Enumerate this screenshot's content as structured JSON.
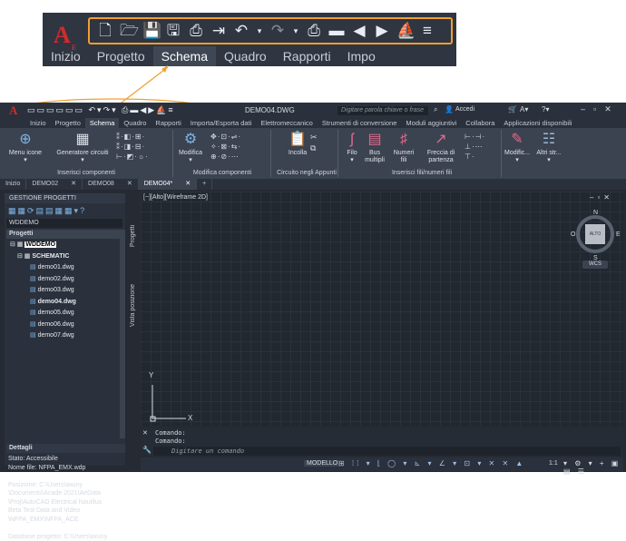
{
  "zoom": {
    "logo_letter": "A",
    "logo_sub": "E",
    "qat_icons": [
      "new-icon",
      "open-icon",
      "save-icon",
      "save-as-icon",
      "export-icon",
      "import-icon",
      "undo-icon",
      "dropdown-icon",
      "redo-icon",
      "dropdown-icon",
      "print-icon",
      "folder-icon",
      "back-icon",
      "forward-icon",
      "surf-icon",
      "customize-icon"
    ],
    "tabs": [
      "Inizio",
      "Progetto",
      "Schema",
      "Quadro",
      "Rapporti",
      "Impo"
    ],
    "active_tab": "Schema"
  },
  "titlebar": {
    "doc_title": "DEMO04.DWG",
    "search_placeholder": "Digitare parola chiave o frase",
    "signin": "Accedi"
  },
  "ribbon_tabs": [
    "Inizio",
    "Progetto",
    "Schema",
    "Quadro",
    "Rapporti",
    "Importa/Esporta dati",
    "Elettromeccanico",
    "Strumenti di conversione",
    "Moduli aggiuntivi",
    "Collabora",
    "Applicazioni disponibili"
  ],
  "ribbon": {
    "menu_icone": "Menu icone",
    "generatore": "Generatore circuiti",
    "inserisci_componenti": "Inserisci componenti",
    "modifica": "Modifica",
    "modifica_componenti": "Modifica componenti",
    "incolla": "Incolla",
    "circuito_appunti": "Circuito negli Appunti",
    "filo": "Filo",
    "bus": "Bus multipli",
    "numeri_fili": "Numeri fili",
    "freccia": "Freccia di partenza",
    "inserisci_fili": "Inserisci fili/numeri fili",
    "modific": "Modific...",
    "altri": "Altri str..."
  },
  "doc_tabs": [
    "Inizio",
    "DEMO02",
    "DEMO08",
    "DEMO04*"
  ],
  "side": {
    "title": "GESTIONE PROGETTI",
    "project_select": "WDDEMO",
    "progetti": "Progetti",
    "root": "WDDEMO",
    "folder": "SCHEMATIC",
    "files": [
      "demo01.dwg",
      "demo02.dwg",
      "demo03.dwg",
      "demo04.dwg",
      "demo05.dwg",
      "demo06.dwg",
      "demo07.dwg"
    ],
    "dettagli": "Dettagli",
    "details": [
      "Stato: Accessibile",
      "Nome file: NFPA_EMX.wdp",
      "",
      "Posizione: C:\\Users\\axuny",
      "\\Documents\\Acade 2021\\AeData",
      "\\Proj\\AutoCAD Electrical Nautilus",
      "Beta Test Data and Video",
      "\\NFPA_EMX\\NFPA_ACE",
      "",
      "Database progetto: C:\\Users\\axuny"
    ],
    "vtab_progetti": "Progetti",
    "vtab_vista": "Vista posizione"
  },
  "canvas": {
    "view_label": "[−][Alto][Wireframe 2D]",
    "compass_n": "N",
    "compass_s": "S",
    "compass_e": "E",
    "compass_o": "O",
    "cube_label": "ALTO",
    "wcs": "WCS",
    "axis_y": "Y",
    "axis_x": "X"
  },
  "cmd": {
    "line1": "Comando:",
    "line2": "Comando:",
    "placeholder": "Digitare un comando"
  },
  "status": {
    "modello": "MODELLO",
    "scale": "1:1"
  },
  "colors": {
    "accent": "#f0a030",
    "logo": "#d42a2a",
    "ribbon": "#3b4350"
  }
}
